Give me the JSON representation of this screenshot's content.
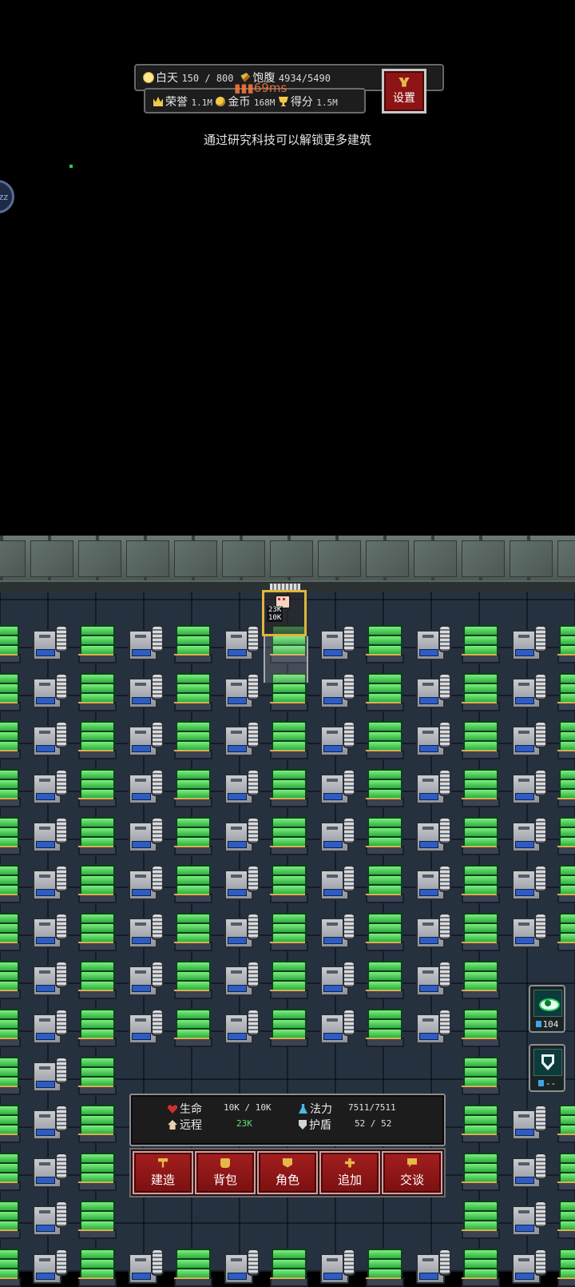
{
  "hud": {
    "day_label": "白天",
    "day_value": "150",
    "day_max": "800",
    "hunger_label": "饱腹",
    "hunger_value": "4934",
    "hunger_max": "5490",
    "honor_label": "荣誉",
    "honor_value": "1.1M",
    "gold_label": "金币",
    "gold_value": "168M",
    "score_label": "得分",
    "score_value": "1.5M",
    "ping": "69ms"
  },
  "settings": {
    "label": "设置"
  },
  "hint_text": "通过研究科技可以解锁更多建筑",
  "sleep_button": {
    "label": "zz"
  },
  "player": {
    "attack": "23K",
    "health": "10K"
  },
  "side_buttons": [
    {
      "icon": "eye-icon",
      "count": "104"
    },
    {
      "icon": "shield-icon",
      "count": "--"
    }
  ],
  "stats": {
    "hp_label": "生命",
    "hp_value": "10K",
    "hp_max": "10K",
    "mana_label": "法力",
    "mana_value": "7511",
    "mana_max": "7511",
    "ranged_label": "远程",
    "ranged_value": "23K",
    "shield_label": "护盾",
    "shield_value": "52",
    "shield_max": "52"
  },
  "actions": [
    {
      "label": "建造",
      "icon": "hammer-icon"
    },
    {
      "label": "背包",
      "icon": "bag-icon"
    },
    {
      "label": "角色",
      "icon": "character-icon"
    },
    {
      "label": "追加",
      "icon": "plus-icon"
    },
    {
      "label": "交谈",
      "icon": "chat-icon"
    }
  ],
  "colors": {
    "accent_red": "#8c1414",
    "gold": "#e0b53a",
    "green_tower": "#25a63a",
    "floor": "#263140"
  }
}
